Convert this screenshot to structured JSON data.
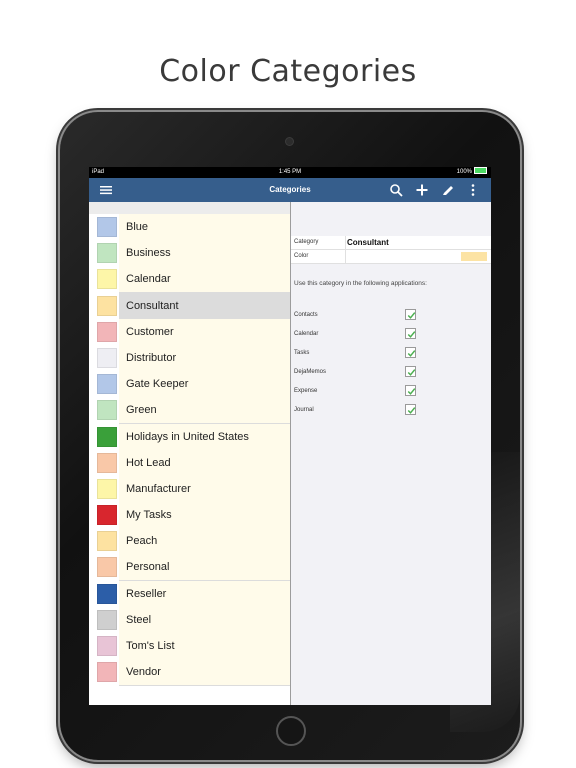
{
  "headline": "Color Categories",
  "status_bar": {
    "device": "iPad",
    "time": "1:45 PM",
    "battery": "100%"
  },
  "navbar": {
    "title": "Categories",
    "icons": [
      "menu-icon",
      "search-icon",
      "plus-icon",
      "pencil-icon",
      "more-vertical-icon"
    ]
  },
  "categories": [
    {
      "name": "Blue",
      "color": "#b2c7e8"
    },
    {
      "name": "Business",
      "color": "#c0e5c0"
    },
    {
      "name": "Calendar",
      "color": "#fdf6a8"
    },
    {
      "name": "Consultant",
      "color": "#fde2a1",
      "selected": true
    },
    {
      "name": "Customer",
      "color": "#f2b5b8"
    },
    {
      "name": "Distributor",
      "color": "#eeeef3"
    },
    {
      "name": "Gate Keeper",
      "color": "#b2c7e8"
    },
    {
      "name": "Green",
      "color": "#c0e5c0"
    },
    {
      "name": "Holidays in United States",
      "color": "#3aa03a"
    },
    {
      "name": "Hot Lead",
      "color": "#f9c8a8"
    },
    {
      "name": "Manufacturer",
      "color": "#fdf6a8"
    },
    {
      "name": "My Tasks",
      "color": "#d8262e"
    },
    {
      "name": "Peach",
      "color": "#fde2a1"
    },
    {
      "name": "Personal",
      "color": "#f9c8a8"
    },
    {
      "name": "Reseller",
      "color": "#2c5ea8"
    },
    {
      "name": "Steel",
      "color": "#cfcfcf"
    },
    {
      "name": "Tom's List",
      "color": "#e8c4d6"
    },
    {
      "name": "Vendor",
      "color": "#f2b5b8"
    }
  ],
  "detail": {
    "category_label": "Category",
    "category_value": "Consultant",
    "color_label": "Color",
    "color_value": "#fce3a4",
    "use_text": "Use this category in the following applications:",
    "applications": [
      {
        "name": "Contacts",
        "checked": true
      },
      {
        "name": "Calendar",
        "checked": true
      },
      {
        "name": "Tasks",
        "checked": true
      },
      {
        "name": "DejaMemos",
        "checked": true
      },
      {
        "name": "Expense",
        "checked": true
      },
      {
        "name": "Journal",
        "checked": true
      }
    ]
  },
  "colors": {
    "navbar": "#365e8c",
    "check": "#4caf50",
    "row_bg": "#fffbea",
    "selected_bg": "#dcdcdc"
  }
}
